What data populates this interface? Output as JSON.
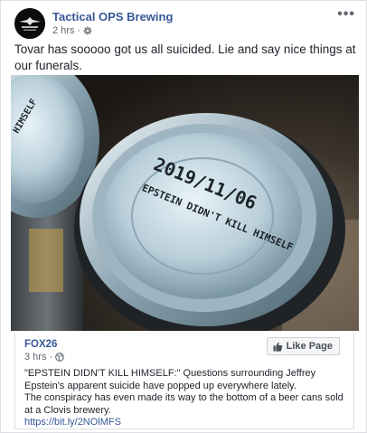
{
  "post": {
    "page_name": "Tactical OPS Brewing",
    "time": "2 hrs",
    "more_glyph": "•••",
    "text": "Tovar has sooooo got us all suicided. Lie and say nice things at our funerals.",
    "avatar_icon": "tactical-ops-logo",
    "privacy_icon": "gear-icon"
  },
  "photo": {
    "can_date": "2019/11/06",
    "can_text": "EPSTEIN DIDN'T KILL HIMSELF",
    "left_can_text": "HIMSELF"
  },
  "link_card": {
    "source": "FOX26",
    "time": "3 hrs",
    "privacy_icon": "globe-icon",
    "like_label": "Like Page",
    "line1": "\"EPSTEIN DIDN'T KILL HIMSELF:\" Questions surrounding Jeffrey Epstein's apparent suicide have popped up everywhere lately.",
    "line2": "The conspiracy has even made its way to the bottom of a beer cans sold at a Clovis brewery.",
    "link": "https://bit.ly/2NOlMFS"
  },
  "colors": {
    "link_blue": "#385898",
    "text": "#1d2129",
    "meta_gray": "#616770"
  }
}
